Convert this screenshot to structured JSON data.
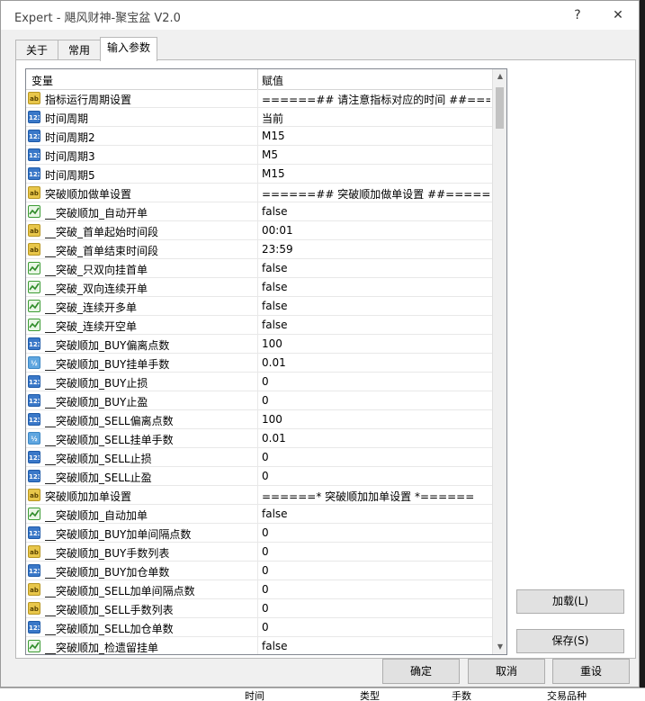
{
  "window": {
    "title": "Expert - 飓风财神-聚宝盆 V2.0",
    "help": "?",
    "close": "✕"
  },
  "tabs": [
    {
      "label": "关于"
    },
    {
      "label": "常用"
    },
    {
      "label": "输入参数"
    }
  ],
  "grid": {
    "col_variable": "变量",
    "col_value": "赋值",
    "rows": [
      {
        "icon": "ab",
        "name": "指标运行周期设置",
        "value": "======## 请注意指标对应的时间 ##====..."
      },
      {
        "icon": "123",
        "name": "时间周期",
        "value": "当前"
      },
      {
        "icon": "123",
        "name": "时间周期2",
        "value": "M15"
      },
      {
        "icon": "123",
        "name": "时间周期3",
        "value": "M5"
      },
      {
        "icon": "123",
        "name": "时间周期5",
        "value": "M15"
      },
      {
        "icon": "ab",
        "name": "突破顺加做单设置",
        "value": "======## 突破顺加做单设置 ##======"
      },
      {
        "icon": "bool",
        "name": "__突破顺加_自动开单",
        "value": "false"
      },
      {
        "icon": "ab",
        "name": "__突破_首单起始时间段",
        "value": "00:01"
      },
      {
        "icon": "ab",
        "name": "__突破_首单结束时间段",
        "value": "23:59"
      },
      {
        "icon": "bool",
        "name": "__突破_只双向挂首单",
        "value": "false"
      },
      {
        "icon": "bool",
        "name": "__突破_双向连续开单",
        "value": "false"
      },
      {
        "icon": "bool",
        "name": "__突破_连续开多单",
        "value": "false"
      },
      {
        "icon": "bool",
        "name": "__突破_连续开空单",
        "value": "false"
      },
      {
        "icon": "123",
        "name": "__突破顺加_BUY偏离点数",
        "value": "100"
      },
      {
        "icon": "half",
        "name": "__突破顺加_BUY挂单手数",
        "value": "0.01"
      },
      {
        "icon": "123",
        "name": "__突破顺加_BUY止损",
        "value": "0"
      },
      {
        "icon": "123",
        "name": "__突破顺加_BUY止盈",
        "value": "0"
      },
      {
        "icon": "123",
        "name": "__突破顺加_SELL偏离点数",
        "value": "100"
      },
      {
        "icon": "half",
        "name": "__突破顺加_SELL挂单手数",
        "value": "0.01"
      },
      {
        "icon": "123",
        "name": "__突破顺加_SELL止损",
        "value": "0"
      },
      {
        "icon": "123",
        "name": "__突破顺加_SELL止盈",
        "value": "0"
      },
      {
        "icon": "ab",
        "name": "突破顺加加单设置",
        "value": "======* 突破顺加加单设置 *======"
      },
      {
        "icon": "bool",
        "name": "__突破顺加_自动加单",
        "value": "false"
      },
      {
        "icon": "123",
        "name": "__突破顺加_BUY加单间隔点数",
        "value": "0"
      },
      {
        "icon": "ab",
        "name": "__突破顺加_BUY手数列表",
        "value": "0"
      },
      {
        "icon": "123",
        "name": "__突破顺加_BUY加仓单数",
        "value": "0"
      },
      {
        "icon": "ab",
        "name": "__突破顺加_SELL加单间隔点数",
        "value": "0"
      },
      {
        "icon": "ab",
        "name": "__突破顺加_SELL手数列表",
        "value": "0"
      },
      {
        "icon": "123",
        "name": "__突破顺加_SELL加仓单数",
        "value": "0"
      },
      {
        "icon": "bool",
        "name": "__突破顺加_检遗留挂单",
        "value": "false"
      }
    ]
  },
  "buttons": {
    "load": "加载(L)",
    "save": "保存(S)",
    "ok": "确定",
    "cancel": "取消",
    "reset": "重设"
  },
  "background_bar": [
    "时间",
    "类型",
    "手数",
    "交易品种"
  ]
}
